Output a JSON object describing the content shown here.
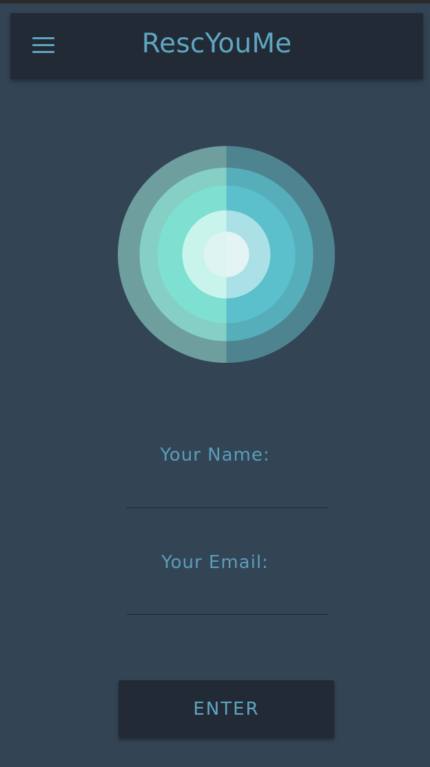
{
  "app_bar": {
    "title": "RescYouMe",
    "menu_icon": "hamburger-menu-icon"
  },
  "logo": {
    "icon": "concentric-circles-logo",
    "colors": {
      "left": [
        "#6e9e9d",
        "#86cfc4",
        "#7ee0d0",
        "#c8f4ec",
        "#ddf4f3"
      ],
      "right": [
        "#4e8490",
        "#56aebb",
        "#5bc0cb",
        "#abe1e6",
        "#e4f3f4"
      ]
    }
  },
  "form": {
    "name_label": "Your Name:",
    "name_value": "",
    "email_label": "Your Email:",
    "email_value": "",
    "enter_label": "ENTER"
  },
  "colors": {
    "background": "#334455",
    "bar": "#222b35",
    "accent": "#5ea6c2"
  }
}
